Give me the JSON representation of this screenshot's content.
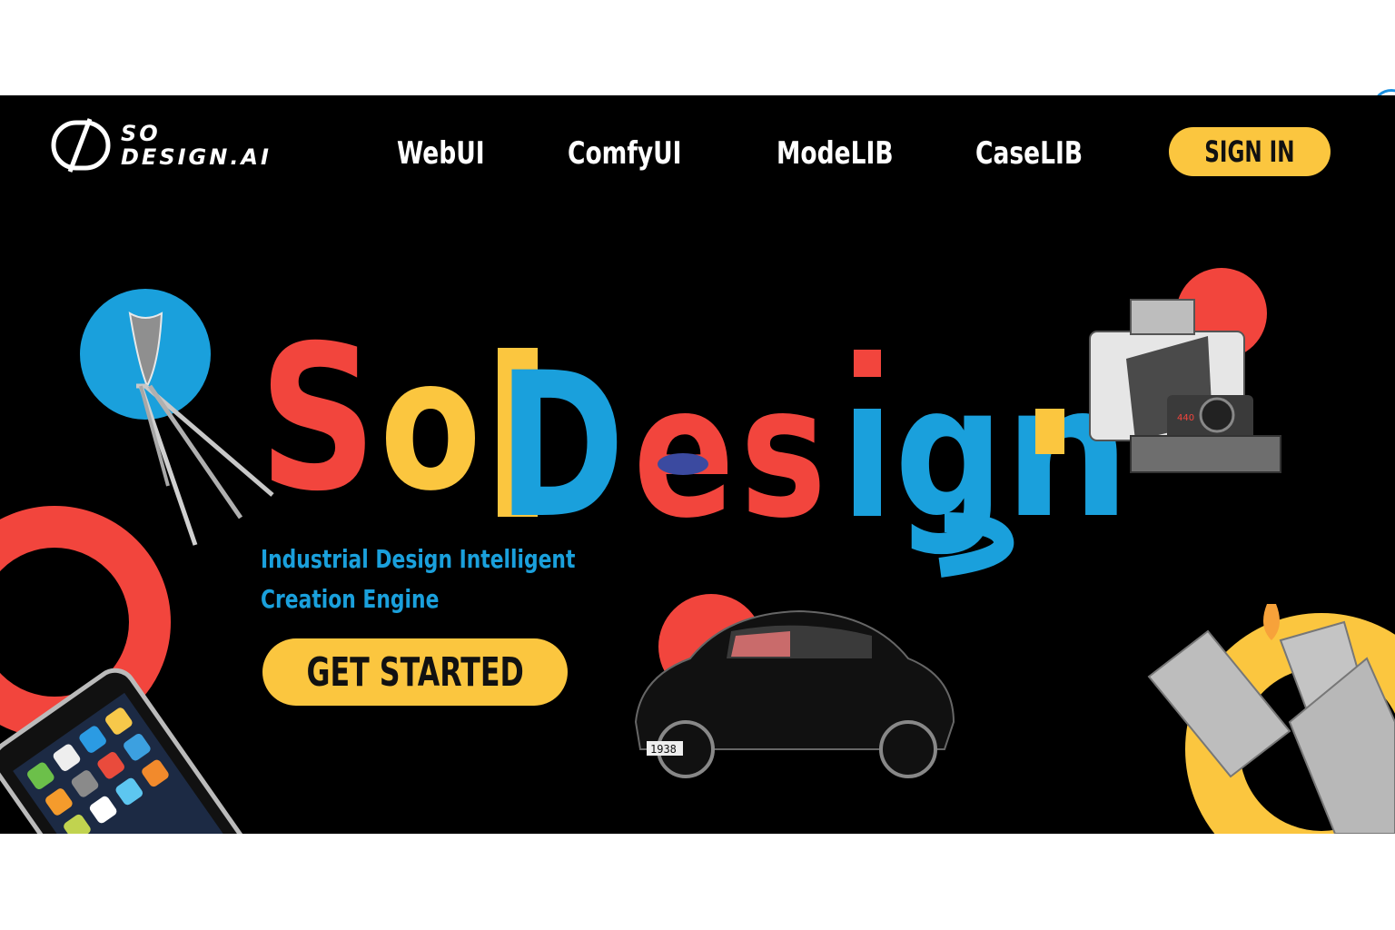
{
  "brand": {
    "logo_line1": "SO",
    "logo_line2": "DESIGN.AI"
  },
  "nav": {
    "items": [
      {
        "label": "WebUI"
      },
      {
        "label": "ComfyUI"
      },
      {
        "label": "ModeLIB"
      },
      {
        "label": "CaseLIB"
      }
    ],
    "sign_in_label": "SIGN IN"
  },
  "hero": {
    "headline": "SoDesign",
    "subtitle_line1": "Industrial Design Intelligent",
    "subtitle_line2": "Creation Engine",
    "cta_label": "GET STARTED"
  },
  "product_images": {
    "camera_label": "440",
    "car_plate": "1938"
  },
  "colors": {
    "background": "#000000",
    "accent_yellow": "#fbc63f",
    "accent_red": "#f2453d",
    "accent_blue": "#1aa0dc",
    "accent_indigo": "#3b4aa0"
  }
}
